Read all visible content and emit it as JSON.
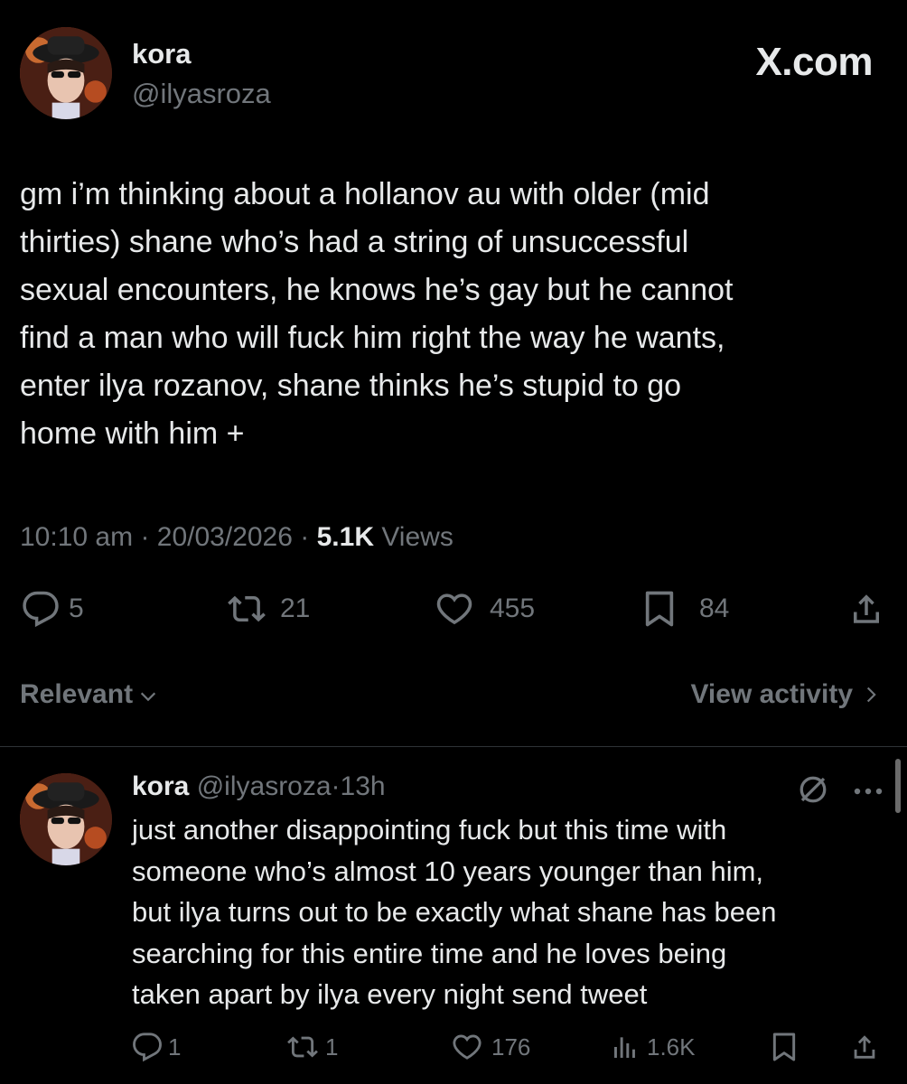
{
  "post": {
    "author_name": "kora",
    "author_handle": "@ilyasroza",
    "site_label": "X.com",
    "text_lines": [
      "gm i’m thinking about a hollanov au with older (mid",
      "thirties) shane who’s had a string of unsuccessful",
      "sexual encounters, he knows he’s gay but he cannot",
      "find a man who will fuck him right the way he wants,",
      "enter ilya rozanov, shane thinks he’s stupid to go",
      "home with him +"
    ],
    "time": "10:10 am",
    "date": "20/03/2026",
    "views_count": "5.1K",
    "views_label": "Views",
    "separator": "·",
    "replies": "5",
    "reposts": "21",
    "likes": "455",
    "bookmarks": "84"
  },
  "filter": {
    "sort_label": "Relevant",
    "view_activity_label": "View activity"
  },
  "reply": {
    "author_name": "kora",
    "author_handle": "@ilyasroza",
    "separator": "·",
    "age": "13h",
    "text_lines": [
      "just another disappointing fuck but this time with",
      "someone who’s almost 10 years younger than him,",
      "but ilya turns out to be exactly what shane has been",
      "searching for this entire time and he loves being",
      "taken apart by ilya every night send tweet"
    ],
    "replies": "1",
    "reposts": "1",
    "likes": "176",
    "views": "1.6K"
  },
  "icons": {
    "more": "more-icon",
    "muted_thread": "no-symbol-icon"
  },
  "colors": {
    "background": "#000000",
    "text": "#e7e9ea",
    "muted": "#71767b",
    "divider": "#2f3336"
  }
}
